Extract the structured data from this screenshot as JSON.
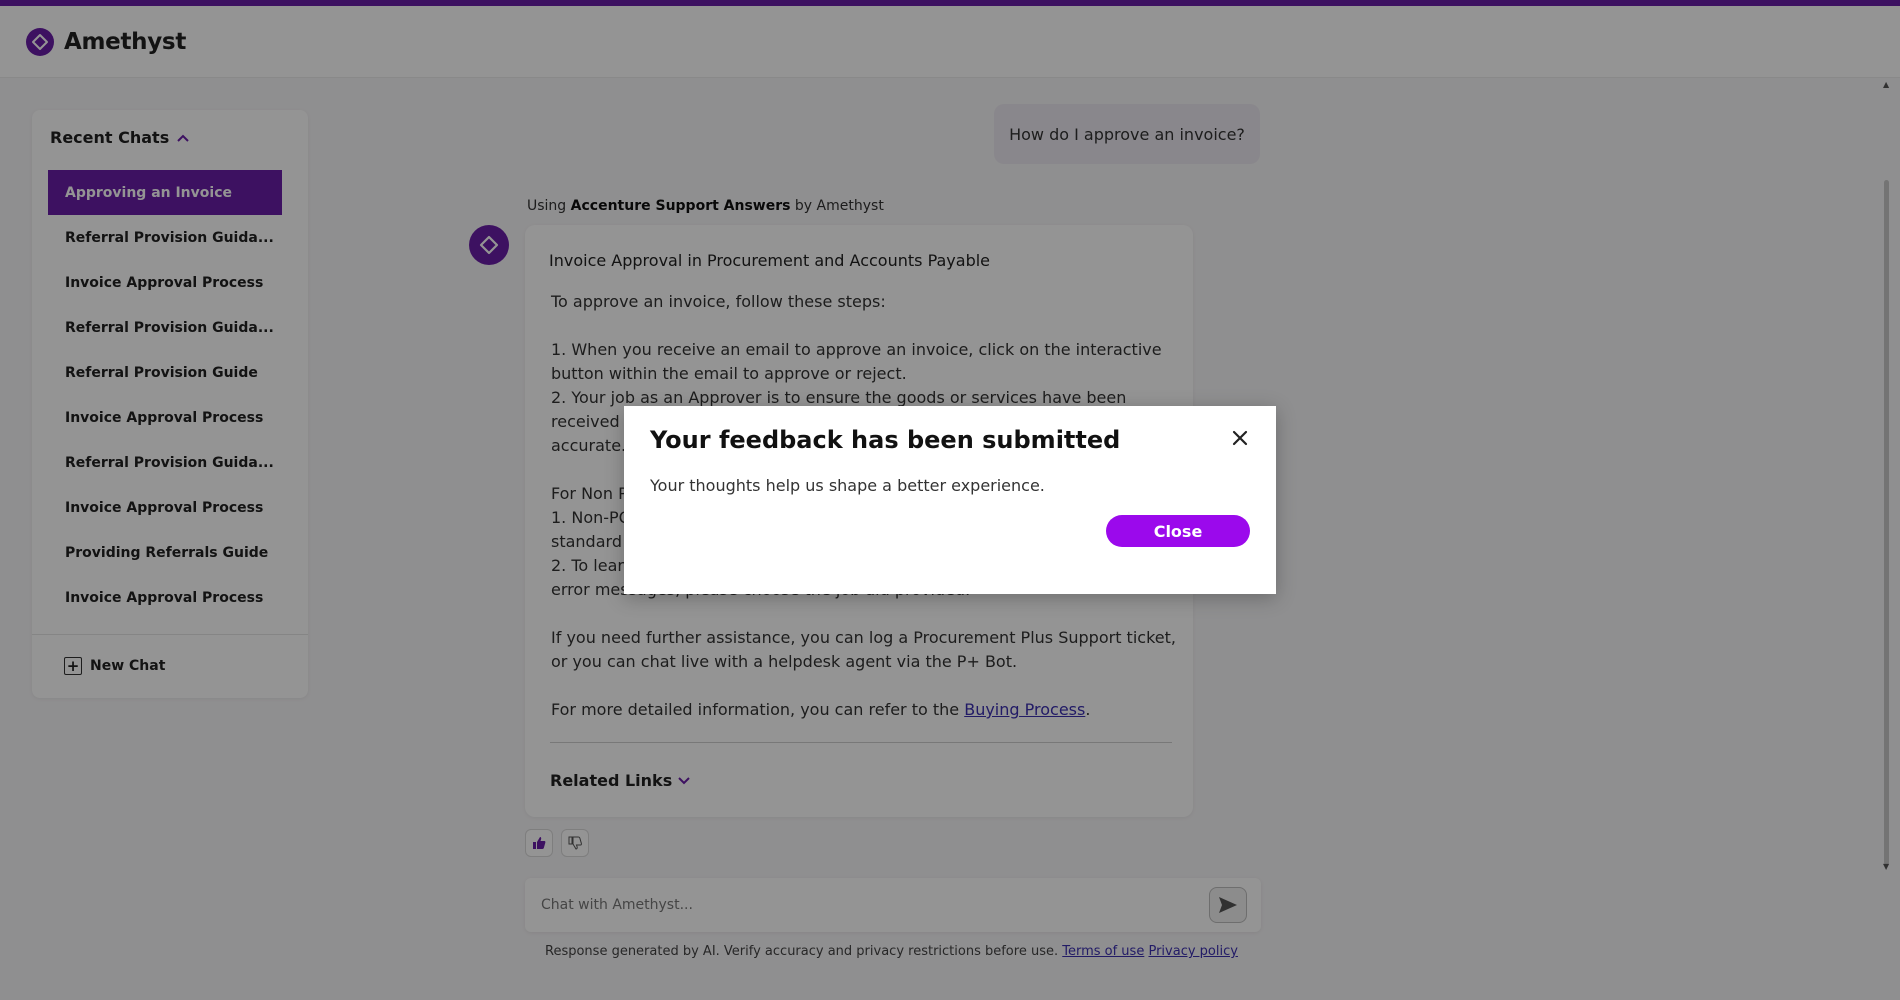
{
  "app": {
    "brand": "Amethyst",
    "accent_color": "#6a1ea8",
    "button_color": "#9b09ec"
  },
  "sidebar": {
    "heading": "Recent Chats",
    "heading_icon": "chevron-up-icon",
    "items": [
      {
        "label": "Approving an Invoice",
        "active": true
      },
      {
        "label": "Referral Provision Guida..."
      },
      {
        "label": "Invoice Approval Process"
      },
      {
        "label": "Referral Provision Guida..."
      },
      {
        "label": "Referral Provision Guide"
      },
      {
        "label": "Invoice Approval Process"
      },
      {
        "label": "Referral Provision Guida..."
      },
      {
        "label": "Invoice Approval Process"
      },
      {
        "label": "Providing Referrals Guide"
      },
      {
        "label": "Invoice Approval Process"
      }
    ],
    "new_chat_label": "New Chat",
    "new_chat_icon": "plus-square-icon"
  },
  "conversation": {
    "user_message": "How do I approve an invoice?",
    "using_prefix": "Using",
    "using_source": "Accenture Support Answers",
    "using_suffix": "by Amethyst",
    "answer": {
      "title": "Invoice Approval in Procurement and Accounts Payable",
      "intro": "To approve an invoice, follow these steps:",
      "steps_1": "1. When you receive an email to approve an invoice, click on the interactive button within the email to approve or reject.",
      "steps_2": "2. Your job as an Approver is to ensure the goods or services have been received as outlined in the Purchase Order and that the invoice amount is accurate. You may review",
      "nonpo_1": "For Non PO invoices:",
      "nonpo_2": "1. Non-PO invoices follow the",
      "nonpo_3": "standard",
      "nonpo_4": "2. To learn",
      "nonpo_5": "error messages, please choose the job aid provided.",
      "assist": "If you need further assistance, you can log a Procurement Plus Support ticket, or you can chat live with a helpdesk agent via the P+ Bot.",
      "more_prefix": "For more detailed information, you can refer to the",
      "more_link": "Buying Process",
      "more_suffix": ".",
      "related_links": "Related Links"
    }
  },
  "input": {
    "placeholder": "Chat with Amethyst...",
    "send_icon": "send-icon"
  },
  "footer": {
    "disclaimer": "Response generated by AI. Verify accuracy and privacy restrictions before use.",
    "terms": "Terms of use",
    "privacy": "Privacy policy"
  },
  "modal": {
    "title": "Your feedback has been submitted",
    "message": "Your thoughts help us shape a better experience.",
    "close_label": "Close",
    "close_icon": "close-icon"
  }
}
